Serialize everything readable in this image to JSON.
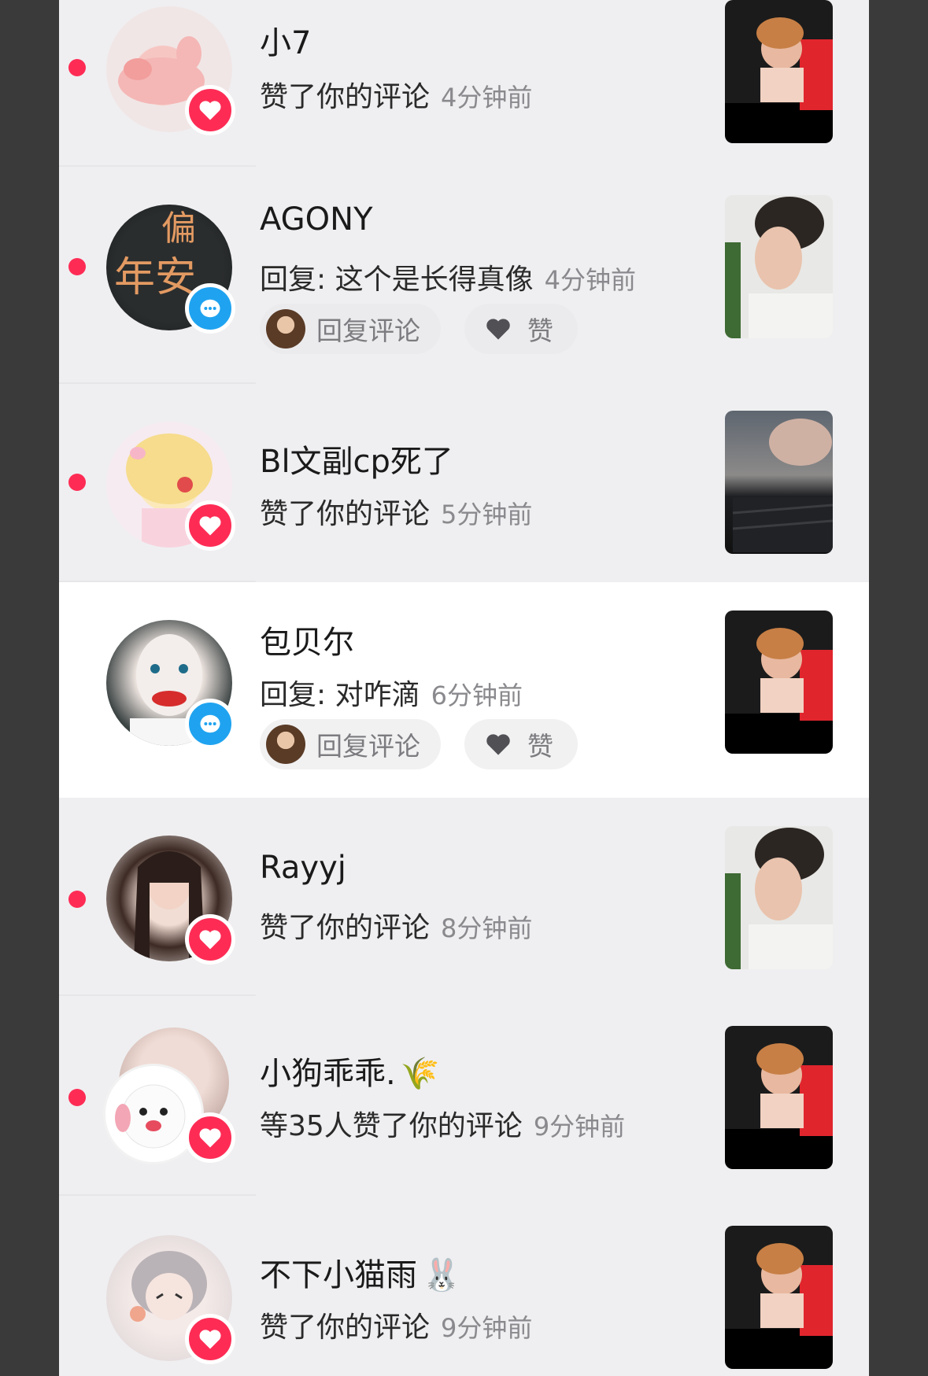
{
  "notifications": [
    {
      "name": "小7",
      "desc": "赞了你的评论",
      "time": "4分钟前",
      "type": "like",
      "unread": true
    },
    {
      "name": "AGONY",
      "desc": "回复: 这个是长得真像",
      "time": "4分钟前",
      "type": "reply",
      "unread": true,
      "reply_label": "回复评论",
      "like_label": "赞"
    },
    {
      "name": "Bl文副cp死了",
      "desc": "赞了你的评论",
      "time": "5分钟前",
      "type": "like",
      "unread": true
    },
    {
      "name": "包贝尔",
      "desc": "回复: 对咋滴",
      "time": "6分钟前",
      "type": "reply",
      "unread": false,
      "reply_label": "回复评论",
      "like_label": "赞"
    },
    {
      "name": "Rayyj",
      "desc": "赞了你的评论",
      "time": "8分钟前",
      "type": "like",
      "unread": true
    },
    {
      "name": "小狗乖乖.",
      "name_emoji": "🌾",
      "desc": "等35人赞了你的评论",
      "time": "9分钟前",
      "type": "like",
      "unread": true
    },
    {
      "name": "不下小猫雨",
      "name_emoji": "🐰",
      "desc": "赞了你的评论",
      "time": "9分钟前",
      "type": "like",
      "unread": false
    }
  ],
  "colors": {
    "accent_like": "#fe2c55",
    "accent_comment": "#1fa3f0",
    "unread_dot": "#fe2c55"
  },
  "icons": {
    "like_badge": "heart-icon",
    "comment_badge": "chat-bubble-icon",
    "like_button": "heart-icon"
  }
}
